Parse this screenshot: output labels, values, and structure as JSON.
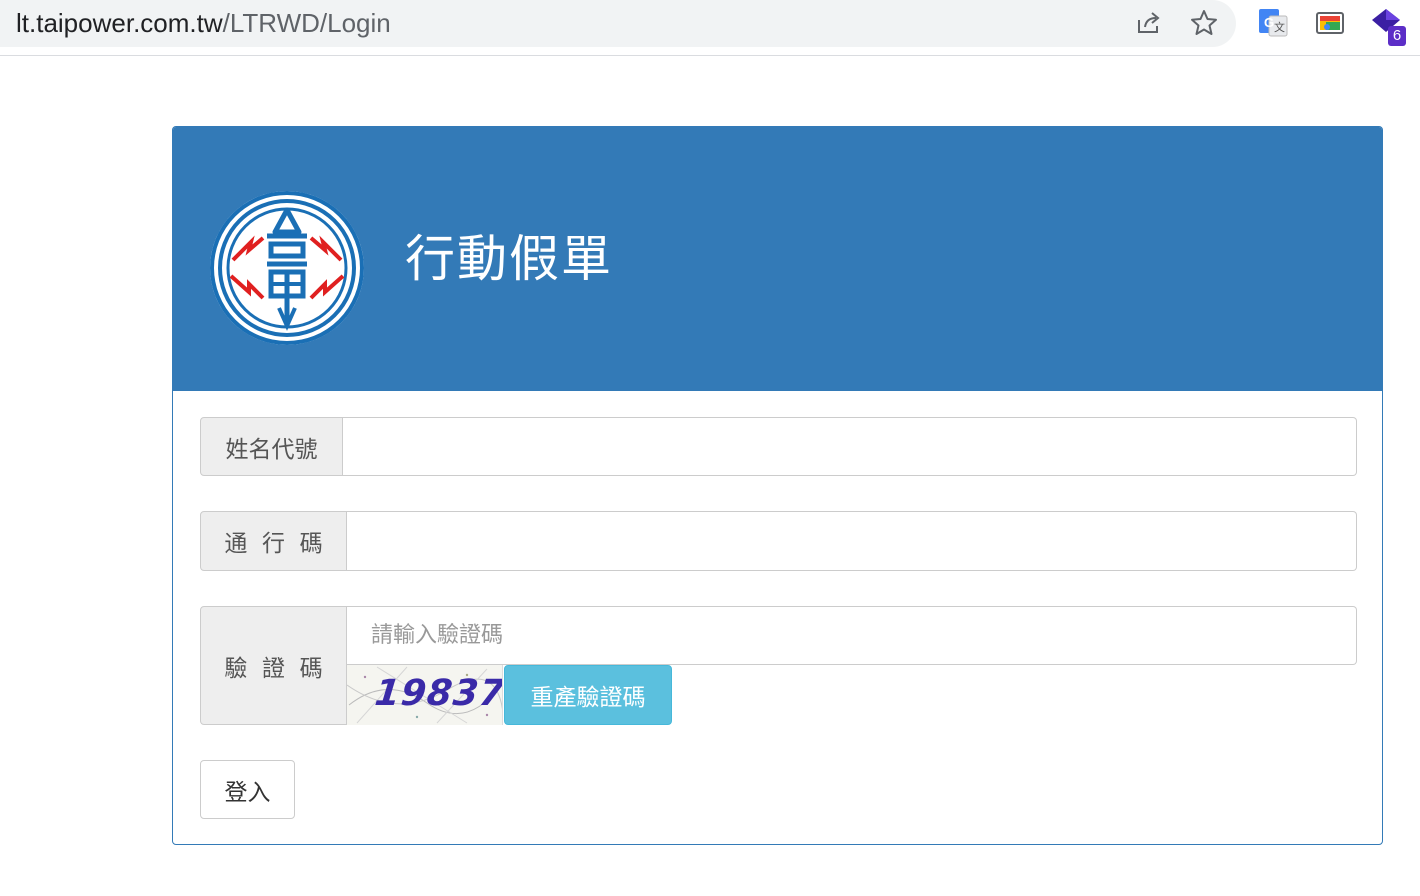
{
  "browser": {
    "url_host": "lt.taipower.com.tw",
    "url_path": "/LTRWD/Login",
    "icons": [
      "share-icon",
      "bookmark-star-icon",
      "google-translate-icon",
      "cast-icon",
      "extension-icon"
    ],
    "extension_badge": "6"
  },
  "header": {
    "logo": "taipower-logo",
    "title": "行動假單"
  },
  "form": {
    "name_label": "姓名代號",
    "name_value": "",
    "password_label": "通  行  碼",
    "password_value": "",
    "captcha_label": "驗  證  碼",
    "captcha_placeholder": "請輸入驗證碼",
    "captcha_image_text": "19837",
    "refresh_captcha_label": "重產驗證碼",
    "login_label": "登入"
  },
  "colors": {
    "primary": "#337ab7",
    "info": "#5bc0de",
    "addon_bg": "#eeeeee"
  }
}
